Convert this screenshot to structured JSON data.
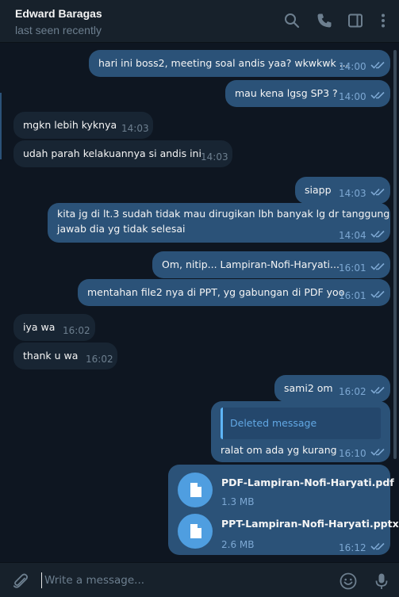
{
  "header": {
    "contact_name": "Edward Baragas",
    "status": "last seen recently",
    "icons": [
      "search-icon",
      "phone-icon",
      "sidebar-icon",
      "more-icon"
    ]
  },
  "messages": [
    {
      "dir": "out",
      "text": "hari ini boss2, meeting soal andis yaa? wkwkwk ...",
      "time": "14:00",
      "read": true
    },
    {
      "dir": "out",
      "text": "mau kena lgsg SP3 ?",
      "time": "14:00",
      "read": true
    },
    {
      "dir": "in",
      "text": "mgkn lebih kyknya",
      "time": "14:03"
    },
    {
      "dir": "in",
      "text": "udah parah kelakuannya si andis ini",
      "time": "14:03"
    },
    {
      "dir": "out",
      "text": "siapp",
      "time": "14:03",
      "read": true
    },
    {
      "dir": "out",
      "line1": "kita jg di lt.3 sudah tidak mau dirugikan lbh banyak lg dr tanggung",
      "line2": "jawab dia yg tidak selesai",
      "time": "14:04",
      "read": true
    },
    {
      "dir": "out",
      "text": "Om, nitip... Lampiran-Nofi-Haryati...",
      "time": "16:01",
      "read": true
    },
    {
      "dir": "out",
      "text": "mentahan file2 nya di PPT, yg gabungan di PDF yoo",
      "time": "16:01",
      "read": true
    },
    {
      "dir": "in",
      "text": "iya wa",
      "time": "16:02"
    },
    {
      "dir": "in",
      "text": "thank u wa",
      "time": "16:02"
    },
    {
      "dir": "out",
      "text": "sami2 om",
      "time": "16:02",
      "read": true
    },
    {
      "dir": "out",
      "reply": "Deleted message",
      "text": "ralat om ada yg kurang",
      "time": "16:10",
      "read": true
    },
    {
      "dir": "out",
      "files": [
        {
          "name": "PDF-Lampiran-Nofi-Haryati.pdf",
          "size": "1.3 MB",
          "icon": "file-icon"
        },
        {
          "name": "PPT-Lampiran-Nofi-Haryati.pptx",
          "size": "2.6 MB",
          "icon": "file-icon"
        }
      ],
      "time": "16:12",
      "read": true
    }
  ],
  "composer": {
    "placeholder": "Write a message...",
    "icons": [
      "attach-icon",
      "emoji-icon",
      "microphone-icon"
    ]
  },
  "colors": {
    "background": "#0e1621",
    "header": "#17212b",
    "outgoing_bubble": "#2b5278",
    "incoming_bubble": "#182533",
    "accent": "#5eb5f7"
  }
}
